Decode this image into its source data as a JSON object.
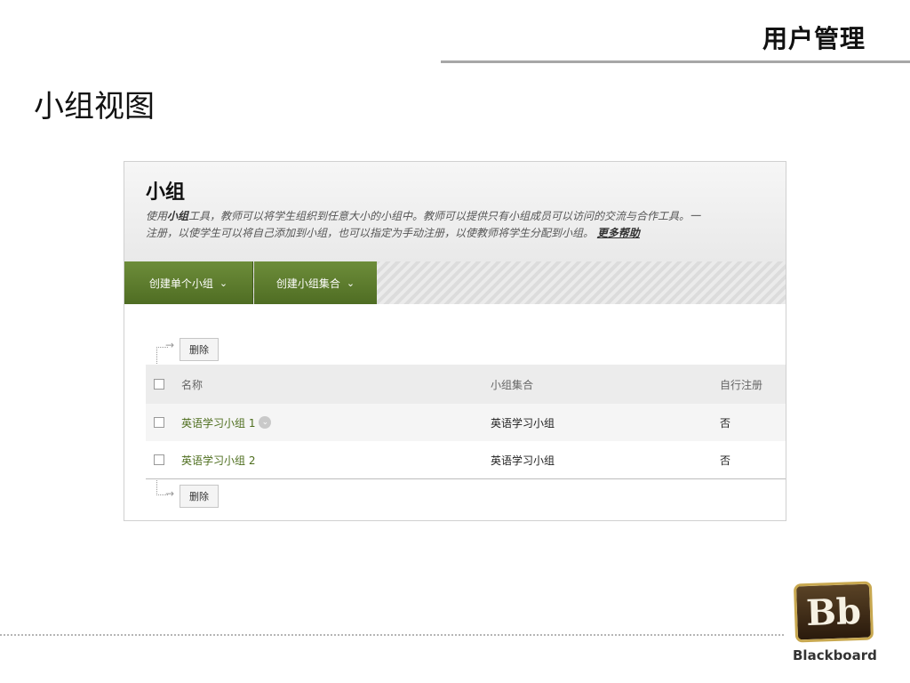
{
  "slide": {
    "header_title": "用户管理",
    "title": "小组视图"
  },
  "panel": {
    "title": "小组",
    "desc_part1": "使用",
    "desc_bold": "小组",
    "desc_part2": "工具，教师可以将学生组织到任意大小的小组中。教师可以提供只有小组成员可以访问的交流与合作工具。一",
    "desc_line2": "注册，以使学生可以将自己添加到小组，也可以指定为手动注册，以使教师将学生分配到小组。",
    "help_link": "更多帮助"
  },
  "actions": {
    "create_single": "创建单个小组",
    "create_set": "创建小组集合"
  },
  "delete_label": "删除",
  "table": {
    "headers": {
      "name": "名称",
      "set": "小组集合",
      "self": "自行注册"
    },
    "rows": [
      {
        "name": "英语学习小组 1",
        "set": "英语学习小组",
        "self": "否"
      },
      {
        "name": "英语学习小组 2",
        "set": "英语学习小组",
        "self": "否"
      }
    ]
  },
  "branding": {
    "logo_text": "Bb",
    "wordmark": "Blackboard"
  },
  "colors": {
    "accent_green": "#5a7a2c",
    "link_green": "#4e6e1e"
  }
}
